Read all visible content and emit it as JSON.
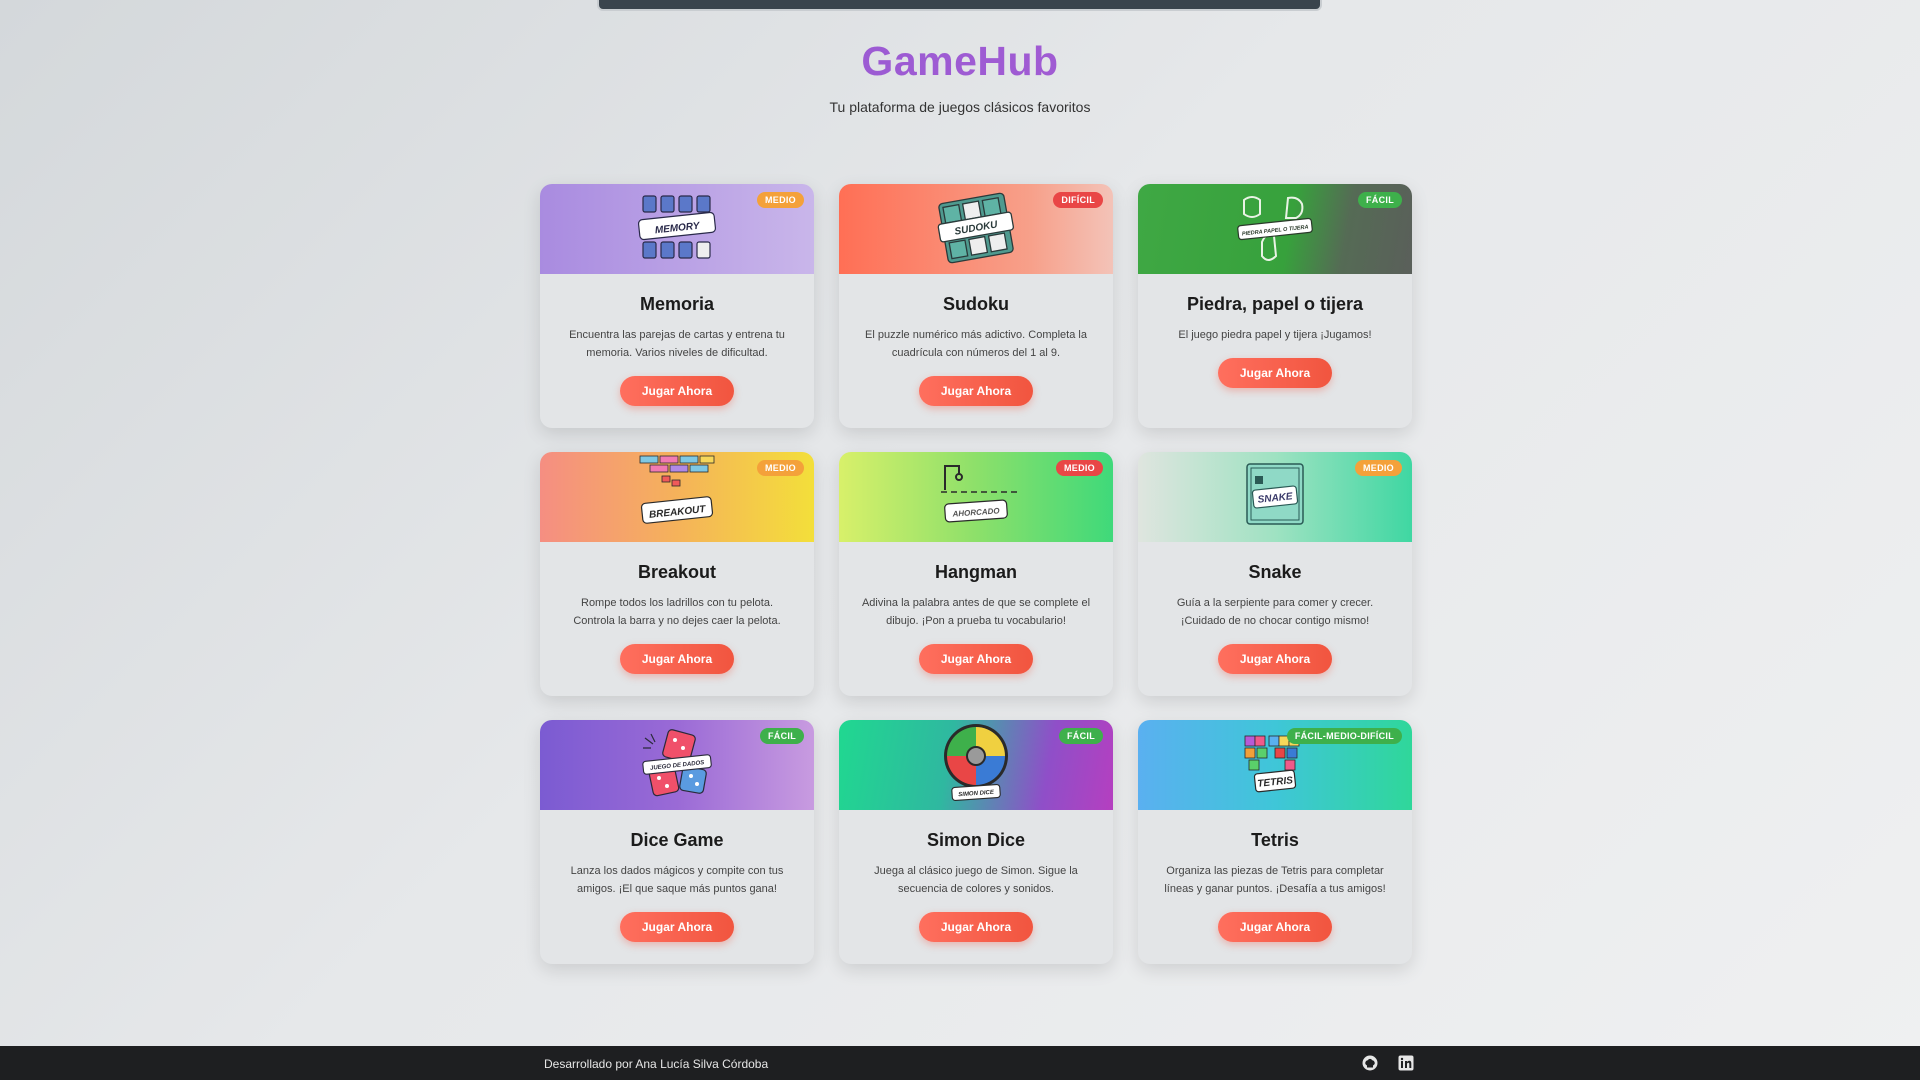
{
  "header": {
    "title": "GameHub",
    "tagline": "Tu plataforma de juegos clásicos favoritos"
  },
  "cards": [
    {
      "title": "Memoria",
      "description": "Encuentra las parejas de cartas y entrena tu memoria. Varios niveles de dificultad.",
      "difficulty": "MEDIO",
      "button": "Jugar Ahora",
      "art_label": "MEMORY"
    },
    {
      "title": "Sudoku",
      "description": "El puzzle numérico más adictivo. Completa la cuadrícula con números del 1 al 9.",
      "difficulty": "DIFÍCIL",
      "button": "Jugar Ahora",
      "art_label": "SUDOKU"
    },
    {
      "title": "Piedra, papel o tijera",
      "description": "El juego piedra papel y tijera ¡Jugamos!",
      "difficulty": "FÁCIL",
      "button": "Jugar Ahora",
      "art_label": "PIEDRA PAPEL O TIJERA"
    },
    {
      "title": "Breakout",
      "description": "Rompe todos los ladrillos con tu pelota. Controla la barra y no dejes caer la pelota.",
      "difficulty": "MEDIO",
      "button": "Jugar Ahora",
      "art_label": "BREAKOUT"
    },
    {
      "title": "Hangman",
      "description": "Adivina la palabra antes de que se complete el dibujo. ¡Pon a prueba tu vocabulario!",
      "difficulty": "MEDIO",
      "button": "Jugar Ahora",
      "art_label": "AHORCADO"
    },
    {
      "title": "Snake",
      "description": "Guía a la serpiente para comer y crecer. ¡Cuidado de no chocar contigo mismo!",
      "difficulty": "MEDIO",
      "button": "Jugar Ahora",
      "art_label": "SNAKE"
    },
    {
      "title": "Dice Game",
      "description": "Lanza los dados mágicos y compite con tus amigos. ¡El que saque más puntos gana!",
      "difficulty": "FÁCIL",
      "button": "Jugar Ahora",
      "art_label": "JUEGO DE DADOS"
    },
    {
      "title": "Simon Dice",
      "description": "Juega al clásico juego de Simon. Sigue la secuencia de colores y sonidos.",
      "difficulty": "FÁCIL",
      "button": "Jugar Ahora",
      "art_label": "SIMON DICE"
    },
    {
      "title": "Tetris",
      "description": "Organiza las piezas de Tetris para completar líneas y ganar puntos. ¡Desafía a tus amigos!",
      "difficulty": "FÁCIL-MEDIO-DIFÍCIL",
      "button": "Jugar Ahora",
      "art_label": "TETRIS"
    }
  ],
  "footer": {
    "credit": "Desarrollado por Ana Lucía Silva Córdoba",
    "icons": [
      "github-icon",
      "linkedin-icon"
    ]
  },
  "colors": {
    "title_gradient": [
      "#8a5bd6",
      "#b25bd0"
    ],
    "button": "#f1553f",
    "badge_medio": "#f4a13a",
    "badge_dificil": "#e94646",
    "badge_facil": "#3eb04b",
    "footer_bg": "#1e1f21"
  }
}
